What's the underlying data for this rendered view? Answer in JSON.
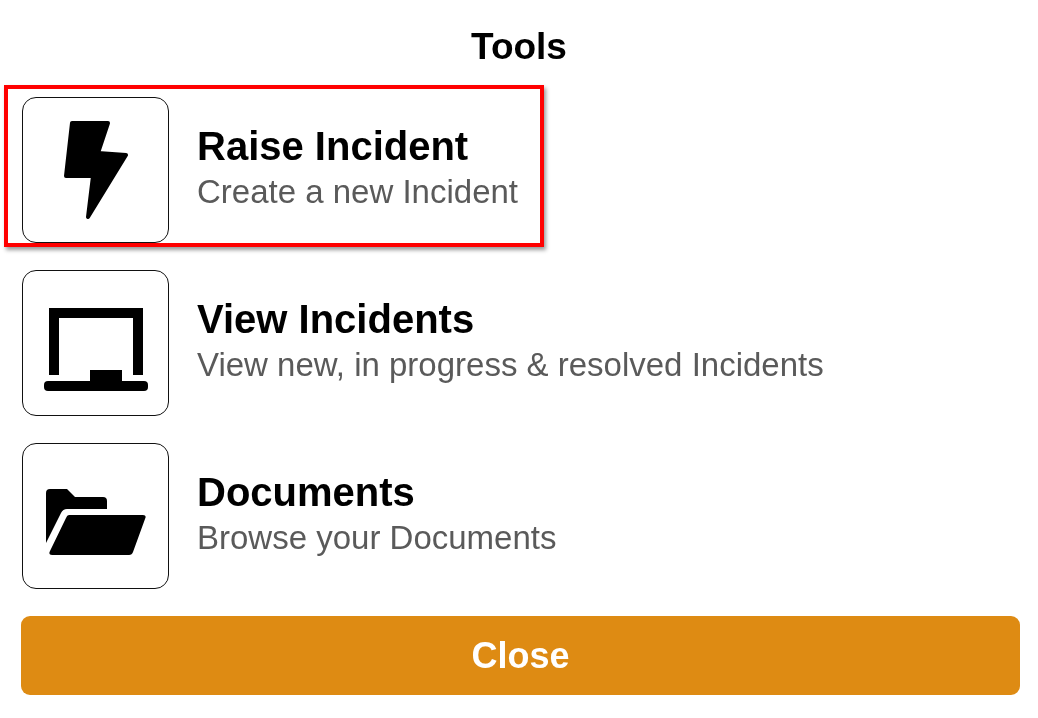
{
  "title": "Tools",
  "items": [
    {
      "title": "Raise Incident",
      "description": "Create a new Incident",
      "selected": true
    },
    {
      "title": "View Incidents",
      "description": "View new, in progress & resolved Incidents",
      "selected": false
    },
    {
      "title": "Documents",
      "description": "Browse your Documents",
      "selected": false
    }
  ],
  "close_button": "Close"
}
